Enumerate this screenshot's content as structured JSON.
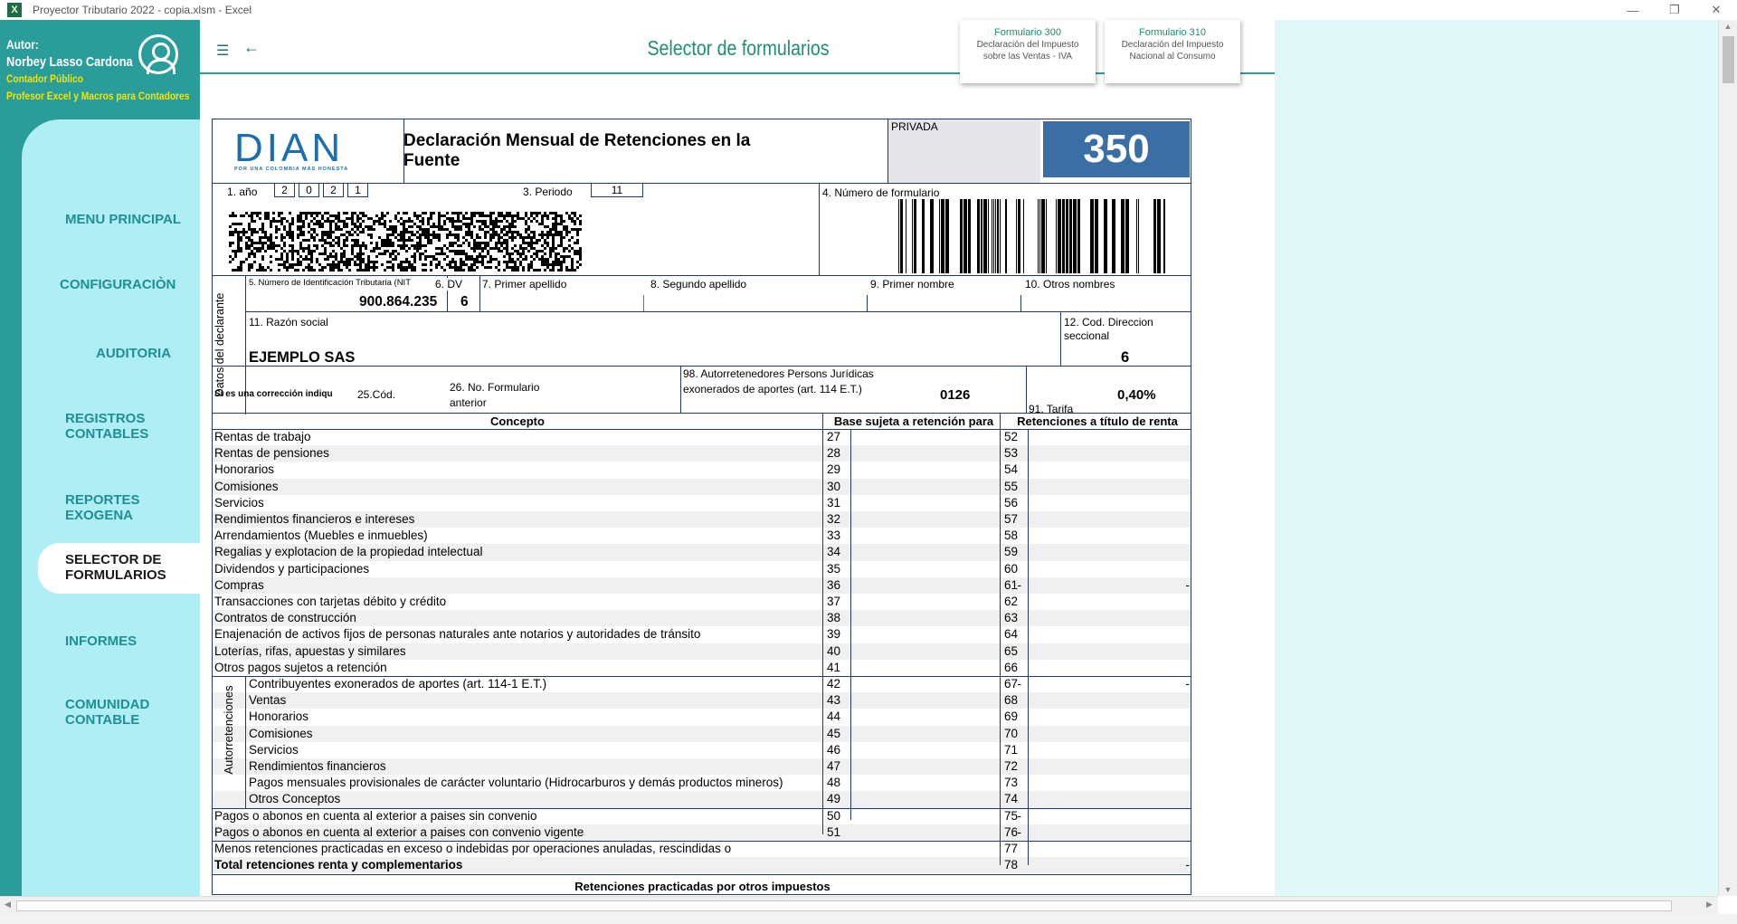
{
  "window": {
    "title": "Proyector Tributario 2022 - copia.xlsm  -  Excel",
    "app_icon": "excel-icon",
    "controls": {
      "minimize": "—",
      "restore": "❐",
      "close": "✕"
    }
  },
  "sidebar": {
    "author_label": "Autor:",
    "author_name": "Norbey Lasso Cardona",
    "author_role": "Contador Público",
    "author_tagline": "Profesor Excel y Macros para Contadores",
    "menu": [
      {
        "label": "MENU PRINCIPAL"
      },
      {
        "label": "CONFIGURACIÒN"
      },
      {
        "label": "AUDITORIA"
      },
      {
        "label": "REGISTROS\nCONTABLES"
      },
      {
        "label": "REPORTES\nEXOGENA"
      },
      {
        "label": "SELECTOR DE\nFORMULARIOS"
      },
      {
        "label": "INFORMES"
      },
      {
        "label": "COMUNIDAD\nCONTABLE"
      }
    ],
    "colors": {
      "panel": "#2a9d9a",
      "menu_bg": "#aeeef4",
      "accent": "#f4e500"
    }
  },
  "header": {
    "title": "Selector de formularios",
    "cards": [
      {
        "title": "Formulario 300",
        "line1": "Declaración del Impuesto",
        "line2": "sobre las Ventas - IVA"
      },
      {
        "title": "Formulario 310",
        "line1": "Declaración del Impuesto",
        "line2": "Nacional al Consumo"
      }
    ]
  },
  "form": {
    "logo_text": "DIAN",
    "logo_sub": "POR UNA COLOMBIA MÁS HONESTA",
    "title": "Declaración Mensual de Retenciones en la Fuente",
    "privada": "PRIVADA",
    "number": "350",
    "year_label": "1. año",
    "year_digits": [
      "2",
      "0",
      "2",
      "1"
    ],
    "period_label": "3. Periodo",
    "period": "11",
    "form_number_label": "4. Número de formulario",
    "nit_label": "5. Número de Identificación Tributaria (NIT",
    "nit": "900.864.235",
    "dv_label": "6. DV",
    "dv": "6",
    "first_surname_label": "7. Primer apellido",
    "second_surname_label": "8. Segundo apellido",
    "first_name_label": "9. Primer nombre",
    "other_names_label": "10. Otros nombres",
    "declarant_label": "Datos del declarante",
    "business_name_label": "11. Razón social",
    "business_name": "EJEMPLO SAS",
    "seccional_label": "12. Cod. Direccion seccional",
    "seccional": "6",
    "correction_label": "Si es una corrección indiqu",
    "cod_label": "25.Cód.",
    "prev_form_label": "26. No. Formulario anterior",
    "autoret_label": "98. Autorretenedores Persons Jurídicas exonerados de aportes (art. 114 E.T.)",
    "autoret_value": "0126",
    "tarifa_label": "91. Tarifa",
    "tarifa": "0,40%",
    "col_concept": "Concepto",
    "col_base": "Base sujeta a retención para",
    "col_ret": "Retenciones a título de renta",
    "autoret_group_label": "Autorretenciones",
    "rows": [
      {
        "concept": "Rentas de trabajo",
        "n1": "27",
        "v1": "",
        "n2": "52",
        "v2": ""
      },
      {
        "concept": "Rentas de pensiones",
        "n1": "28",
        "v1": "",
        "n2": "53",
        "v2": ""
      },
      {
        "concept": "Honorarios",
        "n1": "29",
        "v1": "",
        "n2": "54",
        "v2": ""
      },
      {
        "concept": "Comisiones",
        "n1": "30",
        "v1": "",
        "n2": "55",
        "v2": ""
      },
      {
        "concept": "Servicios",
        "n1": "31",
        "v1": "",
        "n2": "56",
        "v2": ""
      },
      {
        "concept": "Rendimientos financieros e intereses",
        "n1": "32",
        "v1": "",
        "n2": "57",
        "v2": ""
      },
      {
        "concept": "Arrendamientos (Muebles e inmuebles)",
        "n1": "33",
        "v1": "",
        "n2": "58",
        "v2": ""
      },
      {
        "concept": "Regalias y explotacion de la propiedad intelectual",
        "n1": "34",
        "v1": "",
        "n2": "59",
        "v2": ""
      },
      {
        "concept": "Dividendos y participaciones",
        "n1": "35",
        "v1": "",
        "n2": "60",
        "v2": ""
      },
      {
        "concept": "Compras",
        "n1": "36",
        "v1": "-",
        "n2": "61",
        "v2": "-"
      },
      {
        "concept": "Transacciones con tarjetas débito y crédito",
        "n1": "37",
        "v1": "",
        "n2": "62",
        "v2": ""
      },
      {
        "concept": "Contratos de construcción",
        "n1": "38",
        "v1": "",
        "n2": "63",
        "v2": ""
      },
      {
        "concept": "Enajenación de activos fijos de personas naturales ante notarios y autoridades de tránsito",
        "n1": "39",
        "v1": "",
        "n2": "64",
        "v2": ""
      },
      {
        "concept": "Loterías, rifas, apuestas y similares",
        "n1": "40",
        "v1": "",
        "n2": "65",
        "v2": ""
      },
      {
        "concept": "Otros pagos sujetos a retención",
        "n1": "41",
        "v1": "",
        "n2": "66",
        "v2": ""
      }
    ],
    "autoret_rows": [
      {
        "concept": "Contribuyentes exonerados de aportes (art. 114-1 E.T.)",
        "n1": "42",
        "v1": "-",
        "n2": "67",
        "v2": "-"
      },
      {
        "concept": "Ventas",
        "n1": "43",
        "v1": "",
        "n2": "68",
        "v2": ""
      },
      {
        "concept": "Honorarios",
        "n1": "44",
        "v1": "",
        "n2": "69",
        "v2": ""
      },
      {
        "concept": "Comisiones",
        "n1": "45",
        "v1": "",
        "n2": "70",
        "v2": ""
      },
      {
        "concept": "Servicios",
        "n1": "46",
        "v1": "",
        "n2": "71",
        "v2": ""
      },
      {
        "concept": "Rendimientos financieros",
        "n1": "47",
        "v1": "",
        "n2": "72",
        "v2": ""
      },
      {
        "concept": "Pagos mensuales provisionales de carácter voluntario (Hidrocarburos y demás productos mineros)",
        "n1": "48",
        "v1": "",
        "n2": "73",
        "v2": ""
      },
      {
        "concept": "Otros Conceptos",
        "n1": "49",
        "v1": "",
        "n2": "74",
        "v2": ""
      }
    ],
    "foreign_rows": [
      {
        "concept": "Pagos o abonos en cuenta al exterior a paises sin convenio",
        "n1": "50",
        "v1": "-",
        "n2": "75",
        "v2": ""
      },
      {
        "concept": "Pagos o abonos en cuenta al exterior a paises con convenio vigente",
        "n1": "51",
        "v1": "-",
        "n2": "76",
        "v2": ""
      }
    ],
    "less_row": {
      "concept": "Menos retenciones practicadas en exceso o indebidas por operaciones anuladas, rescindidas o",
      "n2": "77",
      "v2": ""
    },
    "total_row": {
      "concept": "Total retenciones renta y complementarios",
      "n2": "78",
      "v2": "-"
    },
    "other_taxes_header": "Retenciones practicadas por otros impuestos"
  }
}
